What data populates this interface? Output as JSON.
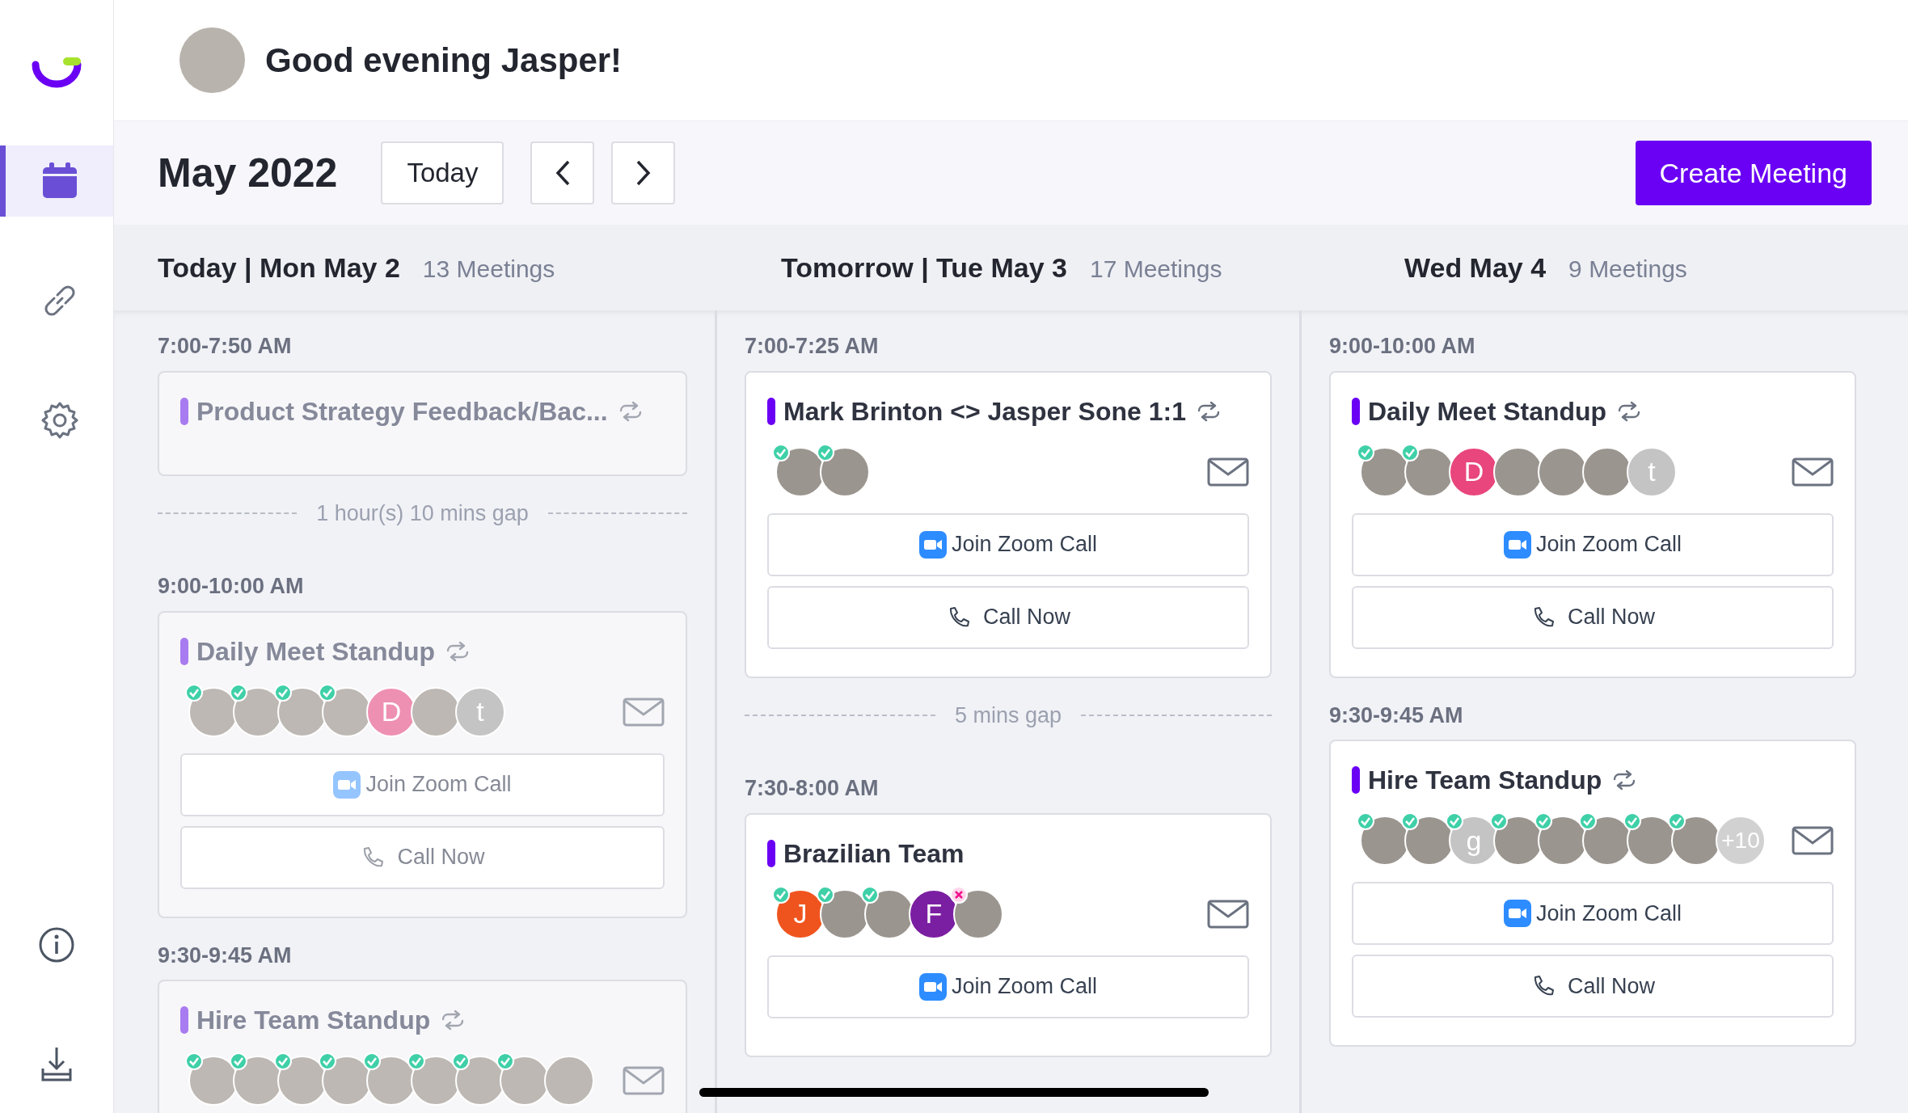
{
  "sidebar": {
    "items": [
      {
        "kind": "calendar",
        "selected": true
      },
      {
        "kind": "link",
        "selected": false
      },
      {
        "kind": "settings",
        "selected": false
      }
    ],
    "bottom_items": [
      {
        "kind": "info"
      },
      {
        "kind": "download"
      }
    ]
  },
  "header": {
    "greeting": "Good evening Jasper!"
  },
  "toolbar": {
    "month": "May 2022",
    "today_button": "Today",
    "create_button": "Create Meeting"
  },
  "days": [
    {
      "title": "Today | Mon May 2",
      "count": "13 Meetings",
      "items": [
        {
          "kind": "meeting",
          "time": "7:00-7:50 AM",
          "title": "Product Strategy Feedback/Bac...",
          "recurring": true,
          "past": true
        },
        {
          "kind": "gap",
          "text": "1 hour(s) 10 mins gap"
        },
        {
          "kind": "meeting",
          "time": "9:00-10:00 AM",
          "title": "Daily Meet Standup",
          "recurring": true,
          "past": true,
          "attendees": [
            {
              "kind": "photo",
              "accepted": true,
              "declined": false
            },
            {
              "kind": "photo",
              "accepted": true,
              "declined": false
            },
            {
              "kind": "photo",
              "accepted": true,
              "declined": false
            },
            {
              "kind": "photo",
              "accepted": true,
              "declined": false
            },
            {
              "kind": "initial",
              "text": "D",
              "color": "#ee90b2",
              "accepted": false,
              "declined": false
            },
            {
              "kind": "photo",
              "accepted": false,
              "declined": false
            },
            {
              "kind": "initial",
              "text": "t",
              "color": "#c4c4c4",
              "accepted": false,
              "declined": false
            }
          ],
          "join_button": "Join Zoom Call",
          "call_button": "Call Now"
        },
        {
          "kind": "meeting",
          "time": "9:30-9:45 AM",
          "title": "Hire Team Standup",
          "recurring": true,
          "past": true,
          "attendees": [
            {
              "kind": "photo",
              "accepted": true,
              "declined": false
            },
            {
              "kind": "photo",
              "accepted": true,
              "declined": false
            },
            {
              "kind": "photo",
              "accepted": true,
              "declined": false
            },
            {
              "kind": "photo",
              "accepted": true,
              "declined": false
            },
            {
              "kind": "photo",
              "accepted": true,
              "declined": false
            },
            {
              "kind": "photo",
              "accepted": true,
              "declined": false
            },
            {
              "kind": "photo",
              "accepted": true,
              "declined": false
            },
            {
              "kind": "photo",
              "accepted": true,
              "declined": false
            },
            {
              "kind": "photo",
              "accepted": false,
              "declined": false
            }
          ]
        }
      ]
    },
    {
      "title": "Tomorrow | Tue May 3",
      "count": "17 Meetings",
      "items": [
        {
          "kind": "meeting",
          "time": "7:00-7:25 AM",
          "title": "Mark Brinton <> Jasper Sone 1:1",
          "recurring": true,
          "past": false,
          "attendees": [
            {
              "kind": "photo",
              "accepted": true,
              "declined": false
            },
            {
              "kind": "photo",
              "accepted": true,
              "declined": false
            }
          ],
          "join_button": "Join Zoom Call",
          "call_button": "Call Now"
        },
        {
          "kind": "gap",
          "text": "5 mins gap"
        },
        {
          "kind": "meeting",
          "time": "7:30-8:00 AM",
          "title": "Brazilian Team",
          "recurring": false,
          "past": false,
          "attendees": [
            {
              "kind": "initial",
              "text": "J",
              "color": "#f0541e",
              "accepted": true,
              "declined": false
            },
            {
              "kind": "photo",
              "accepted": true,
              "declined": false
            },
            {
              "kind": "photo",
              "accepted": true,
              "declined": false
            },
            {
              "kind": "initial",
              "text": "F",
              "color": "#7b1fa2",
              "accepted": false,
              "declined": false
            },
            {
              "kind": "photo",
              "accepted": false,
              "declined": true
            }
          ],
          "join_button": "Join Zoom Call"
        }
      ]
    },
    {
      "title": "Wed May 4",
      "count": "9 Meetings",
      "items": [
        {
          "kind": "meeting",
          "time": "9:00-10:00 AM",
          "title": "Daily Meet Standup",
          "recurring": true,
          "past": false,
          "attendees": [
            {
              "kind": "photo",
              "accepted": true,
              "declined": false
            },
            {
              "kind": "photo",
              "accepted": true,
              "declined": false
            },
            {
              "kind": "initial",
              "text": "D",
              "color": "#e8467c",
              "accepted": false,
              "declined": false
            },
            {
              "kind": "photo",
              "accepted": false,
              "declined": false
            },
            {
              "kind": "photo",
              "accepted": false,
              "declined": false
            },
            {
              "kind": "photo",
              "accepted": false,
              "declined": false
            },
            {
              "kind": "initial",
              "text": "t",
              "color": "#c4c4c4",
              "accepted": false,
              "declined": false
            }
          ],
          "join_button": "Join Zoom Call",
          "call_button": "Call Now"
        },
        {
          "kind": "meeting",
          "time": "9:30-9:45 AM",
          "title": "Hire Team Standup",
          "recurring": true,
          "past": false,
          "attendees": [
            {
              "kind": "photo",
              "accepted": true,
              "declined": false
            },
            {
              "kind": "photo",
              "accepted": true,
              "declined": false
            },
            {
              "kind": "initial",
              "text": "g",
              "color": "#c4c4c4",
              "accepted": true,
              "declined": false
            },
            {
              "kind": "photo",
              "accepted": true,
              "declined": false
            },
            {
              "kind": "photo",
              "accepted": true,
              "declined": false
            },
            {
              "kind": "photo",
              "accepted": true,
              "declined": false
            },
            {
              "kind": "photo",
              "accepted": true,
              "declined": false
            },
            {
              "kind": "photo",
              "accepted": true,
              "declined": false
            },
            {
              "kind": "more",
              "text": "+10",
              "accepted": false,
              "declined": false
            }
          ],
          "join_button": "Join Zoom Call",
          "call_button": "Call Now"
        }
      ]
    }
  ]
}
